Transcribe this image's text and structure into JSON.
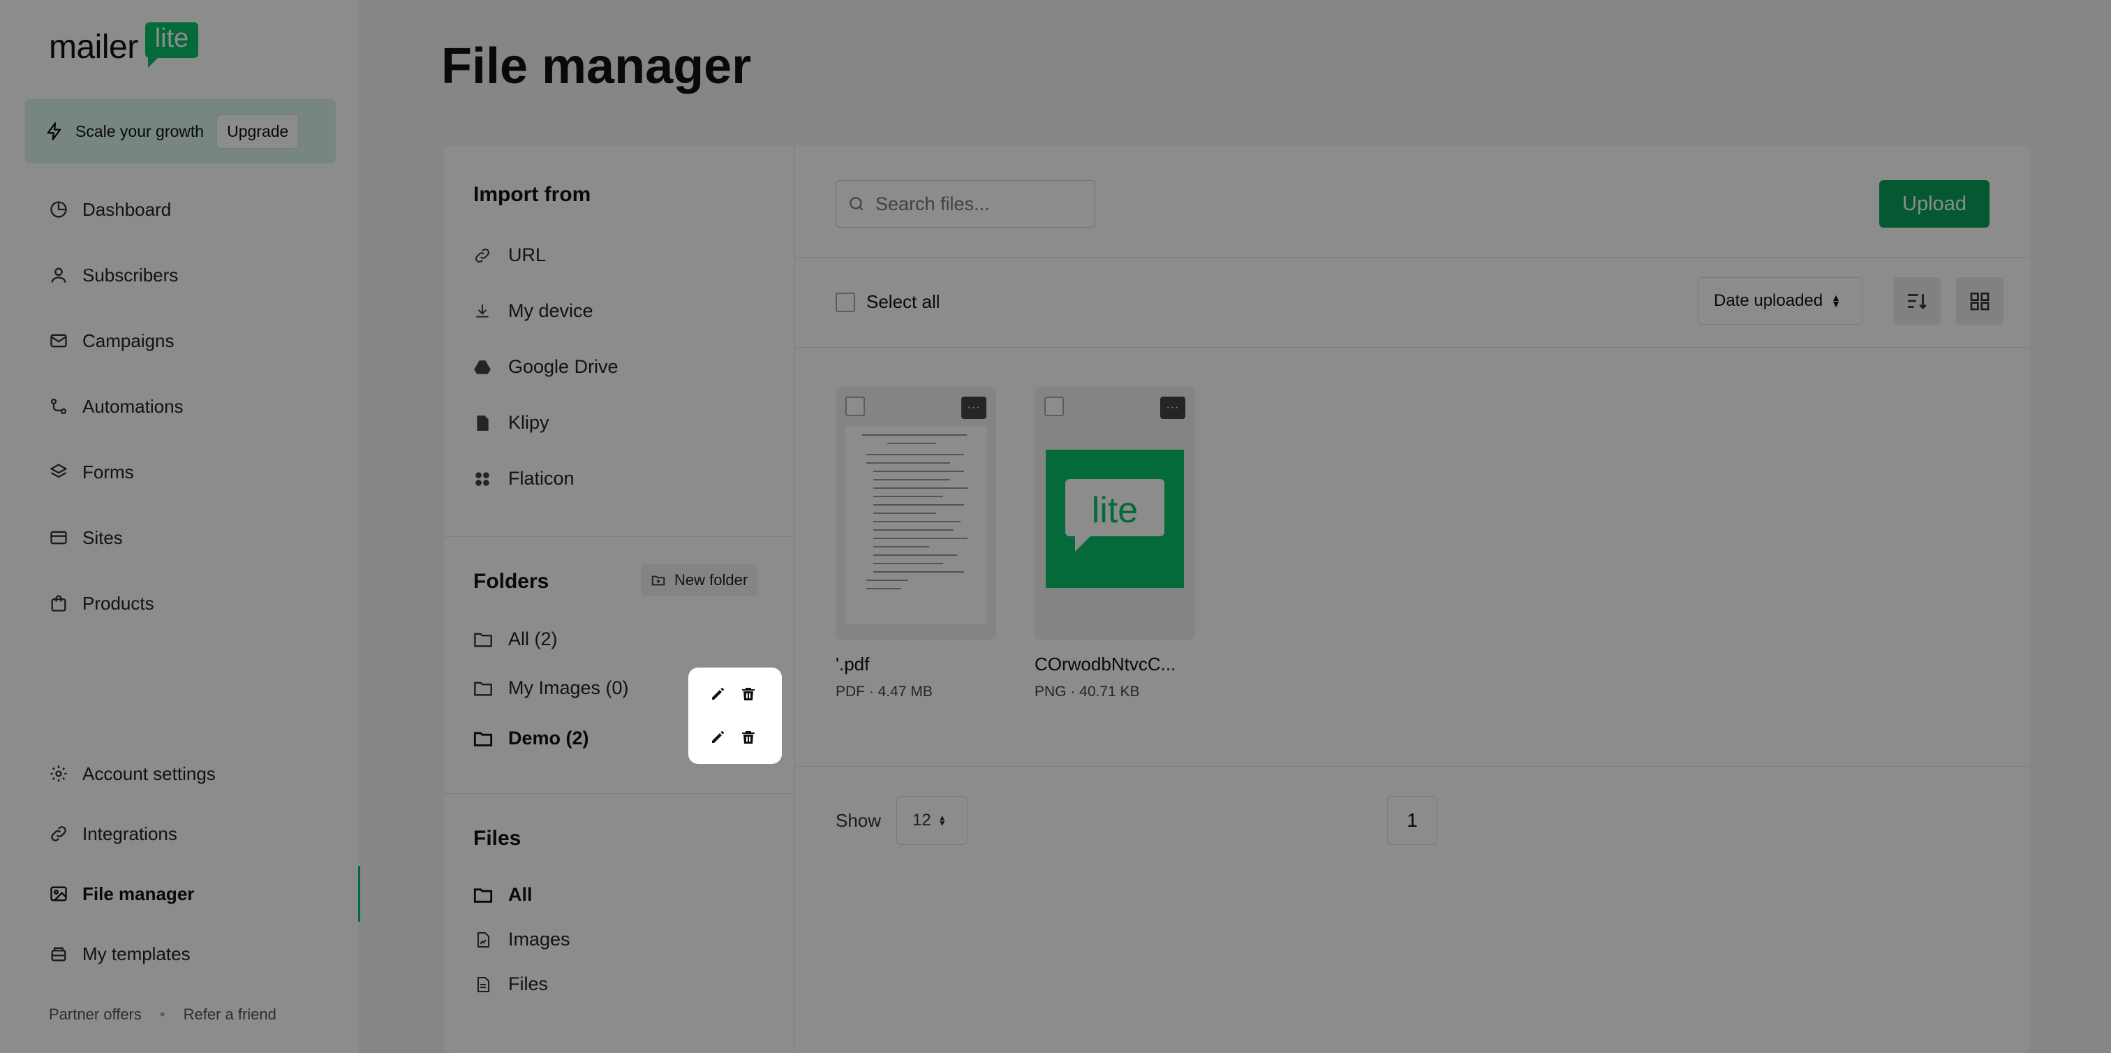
{
  "sidebar": {
    "logo": {
      "word": "mailer",
      "badge": "lite"
    },
    "promo": {
      "text": "Scale your growth",
      "button": "Upgrade"
    },
    "items": [
      {
        "label": "Dashboard",
        "icon": "dashboard-icon"
      },
      {
        "label": "Subscribers",
        "icon": "user-icon"
      },
      {
        "label": "Campaigns",
        "icon": "mail-icon"
      },
      {
        "label": "Automations",
        "icon": "automation-icon"
      },
      {
        "label": "Forms",
        "icon": "layers-icon"
      },
      {
        "label": "Sites",
        "icon": "browser-icon"
      },
      {
        "label": "Products",
        "icon": "bag-icon"
      }
    ],
    "bottom_items": [
      {
        "label": "Account settings",
        "icon": "gear-icon"
      },
      {
        "label": "Integrations",
        "icon": "link-icon"
      },
      {
        "label": "File manager",
        "icon": "image-icon",
        "active": true
      },
      {
        "label": "My templates",
        "icon": "template-icon"
      }
    ],
    "footer": {
      "partner": "Partner offers",
      "refer": "Refer a friend"
    }
  },
  "page": {
    "title": "File manager"
  },
  "import": {
    "title": "Import from",
    "sources": [
      {
        "label": "URL",
        "icon": "link-icon"
      },
      {
        "label": "My device",
        "icon": "download-icon"
      },
      {
        "label": "Google Drive",
        "icon": "google-drive-icon"
      },
      {
        "label": "Klipy",
        "icon": "gif-icon"
      },
      {
        "label": "Flaticon",
        "icon": "flaticon-icon"
      }
    ]
  },
  "folders": {
    "title": "Folders",
    "new_folder": "New folder",
    "items": [
      {
        "label": "All (2)"
      },
      {
        "label": "My Images (0)"
      },
      {
        "label": "Demo (2)"
      }
    ]
  },
  "files_section": {
    "title": "Files",
    "items": [
      {
        "label": "All",
        "icon": "folder-icon"
      },
      {
        "label": "Images",
        "icon": "image-file-icon"
      },
      {
        "label": "Files",
        "icon": "document-icon"
      }
    ]
  },
  "toolbar": {
    "search_placeholder": "Search files...",
    "upload": "Upload",
    "select_all": "Select all",
    "sort": "Date uploaded"
  },
  "files": [
    {
      "name": "'.pdf",
      "meta": "PDF · 4.47 MB"
    },
    {
      "name": "COrwodbNtvcC...",
      "meta": "PNG · 40.71 KB",
      "thumb_text": "lite"
    }
  ],
  "pagination": {
    "show_label": "Show",
    "per_page": "12",
    "page": "1"
  },
  "colors": {
    "brand": "#09c269",
    "upload_button": "#09a25e"
  }
}
